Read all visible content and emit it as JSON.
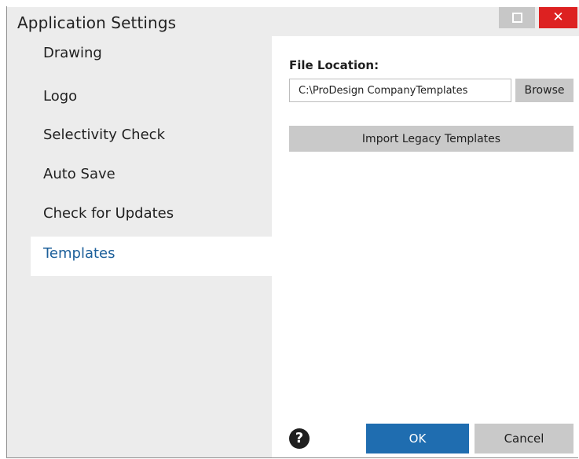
{
  "window": {
    "title": "Application Settings",
    "controls": {
      "restore_icon": "restore-icon",
      "close_symbol": "✕"
    }
  },
  "sidebar": {
    "items": [
      {
        "label": "Drawing"
      },
      {
        "label": "Logo"
      },
      {
        "label": "Selectivity Check"
      },
      {
        "label": "Auto Save"
      },
      {
        "label": "Check for Updates"
      },
      {
        "label": "Templates",
        "active": true
      }
    ]
  },
  "templates": {
    "file_location_label": "File Location:",
    "file_location_value": "C:\\ProDesign CompanyTemplates",
    "browse_label": "Browse",
    "import_label": "Import Legacy Templates"
  },
  "footer": {
    "help_symbol": "?",
    "ok_label": "OK",
    "cancel_label": "Cancel"
  },
  "colors": {
    "accent": "#1f6db0",
    "active_nav_text": "#1c5f9a",
    "close_button": "#dd2121",
    "sidebar_bg": "#ececec",
    "button_gray": "#c9c9c9"
  }
}
